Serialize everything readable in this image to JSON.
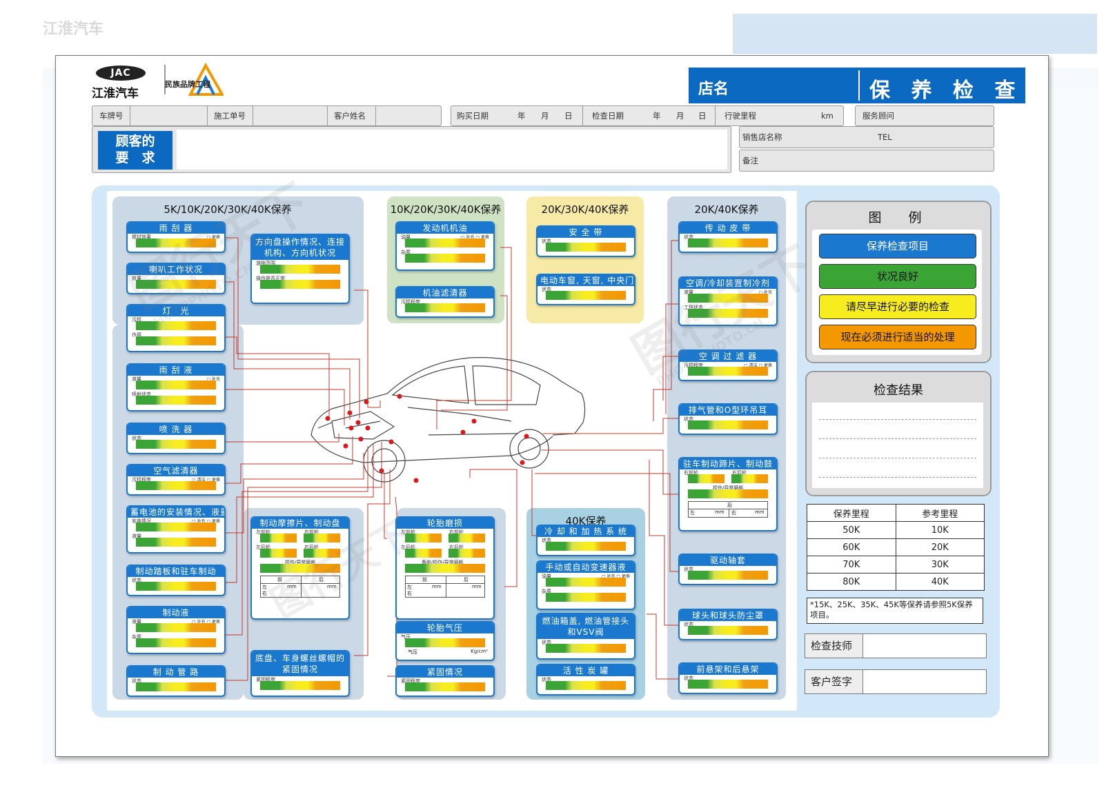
{
  "header": {
    "brand_logo": "JAC",
    "brand_name": "江淮汽车",
    "dealer_brand": "民族品牌工程",
    "shop_label": "店名",
    "title": "保 养 检 查 表"
  },
  "info": {
    "plate": "车牌号",
    "work_order": "施工单号",
    "customer_name": "客户姓名",
    "purchase_date": "购买日期",
    "check_date": "检查日期",
    "year": "年",
    "month": "月",
    "day": "日",
    "mileage": "行驶里程",
    "km": "km",
    "advisor": "服务顾问",
    "store_name": "销售店名称",
    "tel": "TEL",
    "remark": "备注",
    "request_l1": "顾客的",
    "request_l2": "要　求"
  },
  "groups": {
    "g1": "5K/10K/20K/30K/40K保养",
    "g2": "10K/20K/30K/40K保养",
    "g3": "20K/30K/40K保养",
    "g4": "20K/40K保养",
    "g5": "40K保养"
  },
  "cards": {
    "wiper": {
      "title": "雨 刮 器",
      "l1": "擦拭效果",
      "opt": "□ 更换"
    },
    "horn": {
      "title": "喇叭工作状况",
      "l1": "效果"
    },
    "light": {
      "title": "灯　光",
      "l1": "污损",
      "l2": "作用"
    },
    "wiper_fluid": {
      "title": "雨 刮 液",
      "l1": "液量",
      "l2": "喷射状态",
      "opt": "□ 补充"
    },
    "washer": {
      "title": "喷 洗 器",
      "l1": "状态"
    },
    "air_filter": {
      "title": "空气滤清器",
      "l1": "污损程度",
      "opt": "□ 清洁 □ 更换"
    },
    "battery": {
      "title": "蓄电池的安装情况、液量",
      "l1": "安装情况",
      "l2": "液量",
      "opt": "□ 补充 □ 更换"
    },
    "brake_pedal": {
      "title": "制动踏板和驻车制动",
      "l1": "状态"
    },
    "brake_fluid": {
      "title": "制动液",
      "l1": "液量",
      "l2": "杂质",
      "opt": "□ 补充 □ 更换"
    },
    "brake_pipe": {
      "title": "制 动 管 路",
      "l1": "状态"
    },
    "steering": {
      "title": "方向盘操作情况、连接机构、方向机状况",
      "l1": "游隙范围",
      "l2": "操作是否正常"
    },
    "brake_pad": {
      "title": "制动摩擦片、制动盘",
      "l1": "左前轮",
      "l2": "右前轮",
      "l3": "左后轮",
      "l4": "右后轮",
      "l5": "损伤/异常磨耗",
      "t1": "前",
      "t2": "后",
      "t3": "左",
      "t4": "右",
      "mm": "mm"
    },
    "chassis": {
      "title": "底盘、车身螺丝螺帽的紧固情况",
      "l1": "紧固程度"
    },
    "engine_oil": {
      "title": "发动机机油",
      "l1": "油量",
      "l2": "杂质",
      "opt": "□ 补充 □ 更换"
    },
    "oil_filter": {
      "title": "机油滤清器",
      "l1": "污损程度"
    },
    "tire_wear": {
      "title": "轮胎磨损",
      "l1": "左前轮",
      "l2": "右前轮",
      "l3": "左后轮",
      "l4": "右后轮",
      "l5": "备胎/损伤/异常磨耗",
      "t1": "前",
      "t2": "后",
      "t3": "左",
      "t4": "右",
      "mm": "mm"
    },
    "tire_pressure": {
      "title": "轮胎气压",
      "l1": "气压",
      "l2": "气压",
      "unit": "Kg/cm²"
    },
    "fastening": {
      "title": "紧固情况",
      "l1": "紧固程度"
    },
    "seatbelt": {
      "title": "安 全 带",
      "l1": "状态"
    },
    "window": {
      "title": "电动车窗, 天窗, 中央门锁",
      "l1": "状态"
    },
    "belt": {
      "title": "传 动 皮 带",
      "l1": "状态"
    },
    "ac_refrigerant": {
      "title": "空调/冷却装置制冷剂",
      "l1": "液量",
      "l2": "工作状态",
      "opt": "□ 补充"
    },
    "ac_filter": {
      "title": "空 调 过 滤 器",
      "l1": "污损程度",
      "opt": "□ 清洁 □ 更换"
    },
    "exhaust": {
      "title": "排气管和O型环吊耳",
      "l1": "状态"
    },
    "parking_brake": {
      "title": "驻车制动蹄片、制动鼓",
      "l1": "右前轮",
      "l2": "右后轮",
      "l3": "损伤/异常磨耗",
      "t1": "后",
      "t2": "左",
      "t3": "右",
      "mm": "mm"
    },
    "cv_boot": {
      "title": "驱动轴套",
      "l1": "状态"
    },
    "ball_joint": {
      "title": "球头和球头防尘罩",
      "l1": "状态"
    },
    "suspension": {
      "title": "前悬架和后悬架",
      "l1": "状态"
    },
    "cooling": {
      "title": "冷 却 和 加 热 系 统",
      "l1": "状态"
    },
    "trans_fluid": {
      "title": "手动或自动变速器液",
      "l1": "油量",
      "l2": "杂质",
      "opt": "□ 补充 □ 更换"
    },
    "fuel_cap": {
      "title": "燃油箱盖, 燃油管接头和VSV阀",
      "l1": "状态"
    },
    "canister": {
      "title": "活 性 炭 罐",
      "l1": "状态"
    }
  },
  "legend": {
    "title": "图　例",
    "items": [
      "保养检查项目",
      "状况良好",
      "请尽早进行必要的检查",
      "现在必须进行适当的处理"
    ],
    "colors": [
      "#1a78cf",
      "#3aa534",
      "#f7ec1e",
      "#f39800"
    ]
  },
  "result": {
    "title": "检查结果"
  },
  "km_table": {
    "headers": [
      "保养里程",
      "参考里程"
    ],
    "rows": [
      [
        "50K",
        "10K"
      ],
      [
        "60K",
        "20K"
      ],
      [
        "70K",
        "30K"
      ],
      [
        "80K",
        "40K"
      ]
    ]
  },
  "note": "*15K、25K、35K、45K等保养请参照5K保养项目。",
  "sign": {
    "technician": "检查技师",
    "customer": "客户签字"
  },
  "watermark": {
    "text": "图行天下",
    "sub": "PHOTOPHOTO.CN"
  }
}
